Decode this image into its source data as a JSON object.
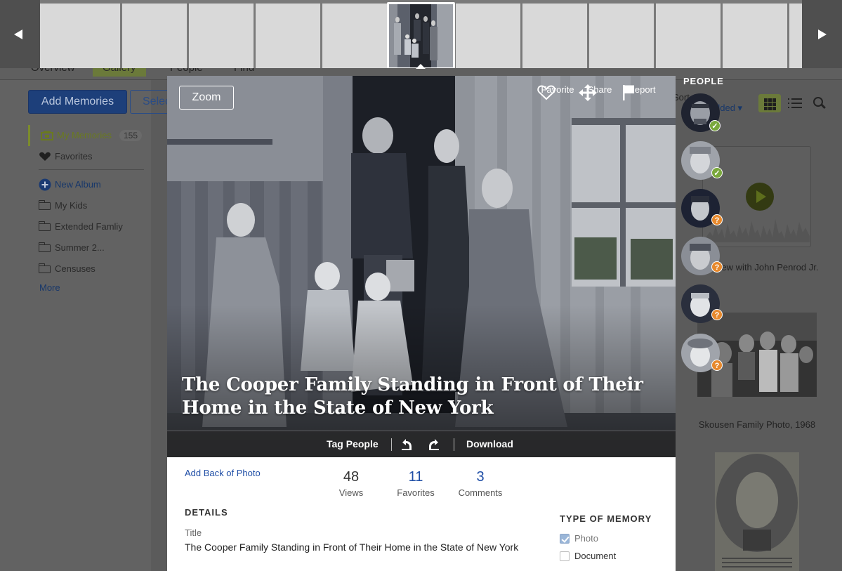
{
  "background_page": {
    "nav_tabs": [
      "Overview",
      "Gallery",
      "People",
      "Find"
    ],
    "add_memories_label": "Add Memories",
    "select_label": "Selec",
    "sidebar": {
      "my_memories": {
        "label": "My Memories",
        "count": "155"
      },
      "favorites": "Favorites",
      "new_album": "New Album",
      "albums": [
        "My Kids",
        "Extended Famliy",
        "Summer 2...",
        "Censuses"
      ],
      "more": "More"
    },
    "sort_label": "Sort",
    "sort_value": "dded",
    "audio_caption": "iew with John Penrod Jr.",
    "photo_caption": "Skousen Family Photo, 1968"
  },
  "filmstrip": {
    "prev_icon": "triangle-left",
    "next_icon": "triangle-right",
    "thumbnail_count": 12,
    "active_index": 5
  },
  "viewer": {
    "zoom_label": "Zoom",
    "actions": {
      "favorite": "Favorite",
      "share": "Share",
      "report": "Report"
    },
    "photo_title": "The Cooper Family Standing in Front of Their Home in the State of New York",
    "bar": {
      "tag_people": "Tag People",
      "rotate_left_icon": "rotate-left-icon",
      "rotate_right_icon": "rotate-right-icon",
      "download": "Download"
    },
    "add_back_of_photo": "Add Back of Photo",
    "stats": {
      "views": {
        "value": "48",
        "label": "Views"
      },
      "favorites": {
        "value": "11",
        "label": "Favorites"
      },
      "comments": {
        "value": "3",
        "label": "Comments"
      }
    },
    "details": {
      "heading": "DETAILS",
      "title_label": "Title",
      "title_value": "The Cooper Family Standing in Front of Their Home in the State of New York"
    },
    "type_of_memory": {
      "heading": "TYPE OF MEMORY",
      "options": [
        {
          "label": "Photo",
          "checked": true
        },
        {
          "label": "Document",
          "checked": false
        }
      ]
    }
  },
  "people_panel": {
    "heading": "PEOPLE",
    "people": [
      {
        "status": "confirmed"
      },
      {
        "status": "confirmed"
      },
      {
        "status": "unconfirmed"
      },
      {
        "status": "unconfirmed"
      },
      {
        "status": "unconfirmed"
      },
      {
        "status": "unconfirmed"
      }
    ]
  },
  "colors": {
    "accent_blue": "#1f4ea6",
    "primary_button": "#1d3f7a",
    "confirmed_badge": "#7aa83c",
    "unconfirmed_badge": "#e7892d"
  }
}
